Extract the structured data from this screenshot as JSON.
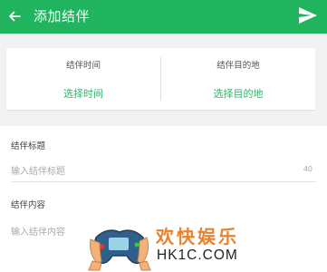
{
  "header": {
    "title": "添加结伴",
    "back_icon": "arrow-left-icon",
    "send_icon": "send-icon",
    "color": "#21b45f"
  },
  "time_card": {
    "left": {
      "label": "结伴时间",
      "action": "选择时间"
    },
    "right": {
      "label": "结伴目的地",
      "action": "选择目的地"
    },
    "accent": "#2fb56c"
  },
  "form": {
    "title_label": "结伴标题",
    "title_placeholder": "输入结伴标题",
    "title_counter": "40",
    "content_label": "结伴内容",
    "content_placeholder": "输入结伴内容"
  },
  "watermark": {
    "text_cn": "欢快娱乐",
    "text_en": "HK1C.COM",
    "icon": "game-controller-icon"
  }
}
